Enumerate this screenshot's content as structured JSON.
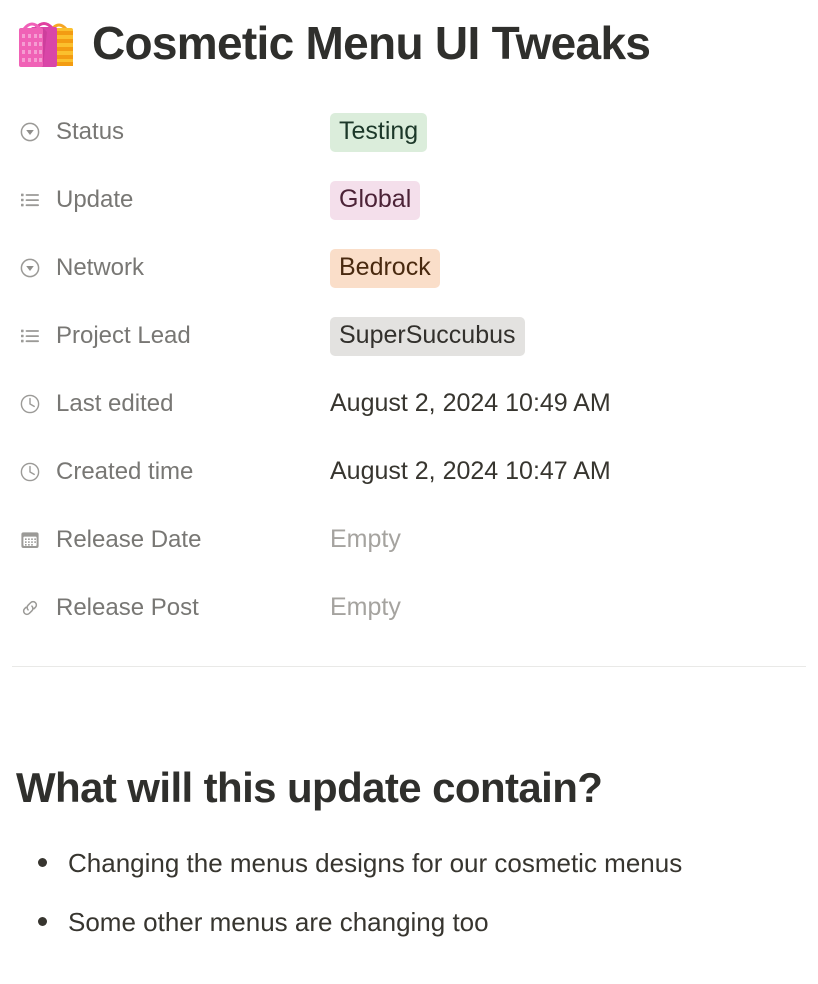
{
  "header": {
    "emoji_name": "shopping-bags-emoji",
    "title": "Cosmetic Menu UI Tweaks"
  },
  "properties": [
    {
      "icon": "select-circle-chevron-icon",
      "label": "Status",
      "value": "Testing",
      "value_kind": "pill",
      "pill_class": "pill-green",
      "pill_bg": "#dbeddb",
      "pill_fg": "#1c3829"
    },
    {
      "icon": "multi-select-list-icon",
      "label": "Update",
      "value": "Global",
      "value_kind": "pill",
      "pill_class": "pill-pink",
      "pill_bg": "#f4dfeb",
      "pill_fg": "#4c2337"
    },
    {
      "icon": "select-circle-chevron-icon",
      "label": "Network",
      "value": "Bedrock",
      "value_kind": "pill",
      "pill_class": "pill-orange",
      "pill_bg": "#fadec9",
      "pill_fg": "#49290f"
    },
    {
      "icon": "multi-select-list-icon",
      "label": "Project Lead",
      "value": "SuperSuccubus",
      "value_kind": "pill",
      "pill_class": "pill-gray",
      "pill_bg": "#e3e2e0",
      "pill_fg": "#32302c"
    },
    {
      "icon": "clock-icon",
      "label": "Last edited",
      "value": "August 2, 2024 10:49 AM",
      "value_kind": "text"
    },
    {
      "icon": "clock-icon",
      "label": "Created time",
      "value": "August 2, 2024 10:47 AM",
      "value_kind": "text"
    },
    {
      "icon": "calendar-icon",
      "label": "Release Date",
      "value": "Empty",
      "value_kind": "empty"
    },
    {
      "icon": "link-icon",
      "label": "Release Post",
      "value": "Empty",
      "value_kind": "empty"
    }
  ],
  "content": {
    "heading": "What will this update contain?",
    "bullets": [
      "Changing the menus designs for our cosmetic menus",
      "Some other menus are changing too"
    ]
  },
  "colors": {
    "page_background": "#ffffff",
    "title_text": "#2f2f2c",
    "property_label_text": "#787774",
    "property_icon": "#9b9a97",
    "value_text": "#37352f",
    "empty_text": "#a5a39f",
    "divider": "#e9e9e7"
  }
}
